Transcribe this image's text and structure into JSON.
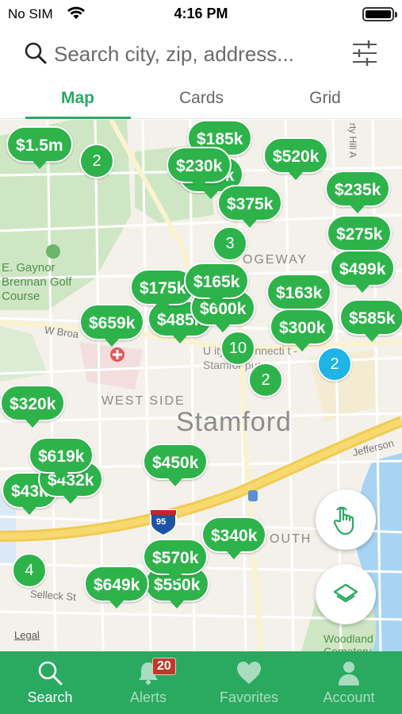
{
  "status_bar": {
    "carrier": "No SIM",
    "time": "4:16 PM",
    "icons": [
      "wifi-icon",
      "battery-icon"
    ]
  },
  "search": {
    "placeholder": "Search city, zip, address...",
    "value": "",
    "icons": [
      "search-icon",
      "filter-sliders-icon"
    ]
  },
  "view_tabs": [
    {
      "label": "Map",
      "active": true
    },
    {
      "label": "Cards",
      "active": false
    },
    {
      "label": "Grid",
      "active": false
    }
  ],
  "map": {
    "labels": {
      "golf": "E. Gaynor Brennan Golf Course",
      "west_side": "WEST SIDE",
      "city": "Stamford",
      "ridgeway": "OGEWAY",
      "w_broad": "W Broa",
      "uconn": "U    ity of Connecti  t - Stamfor    pus",
      "jefferson": "Jefferson",
      "south": "OUTH",
      "selleck": "Selleck St",
      "woodland": "Woodland Cemetery",
      "legal": "Legal",
      "hill": "rty Hill A",
      "highway": "95"
    },
    "price_pins": [
      "$185k",
      "$230k",
      "$520k",
      "$1.5m",
      "$375k",
      "$235k",
      "$275k",
      "$499k",
      "$175k",
      "$165k",
      "$163k",
      "$659k",
      "$485k",
      "$600k",
      "$300k",
      "$585k",
      "$320k",
      "$619k",
      "$432k",
      "$43k",
      "$450k",
      "$340k",
      "$570k",
      "$649k",
      "$550k"
    ],
    "clusters": [
      "2",
      "3",
      "10",
      "2",
      "2",
      "4"
    ],
    "accent_color": "#2db34a",
    "cluster_blue": "#1fb4e6"
  },
  "map_buttons": {
    "draw": "hand-pointer-draw-icon",
    "layers": "layers-icon"
  },
  "tabbar": {
    "items": [
      {
        "label": "Search",
        "icon": "search-icon",
        "active": true
      },
      {
        "label": "Alerts",
        "icon": "bell-icon",
        "active": false,
        "badge": "20"
      },
      {
        "label": "Favorites",
        "icon": "heart-icon",
        "active": false
      },
      {
        "label": "Account",
        "icon": "person-icon",
        "active": false
      }
    ],
    "color": "#2aa960"
  }
}
